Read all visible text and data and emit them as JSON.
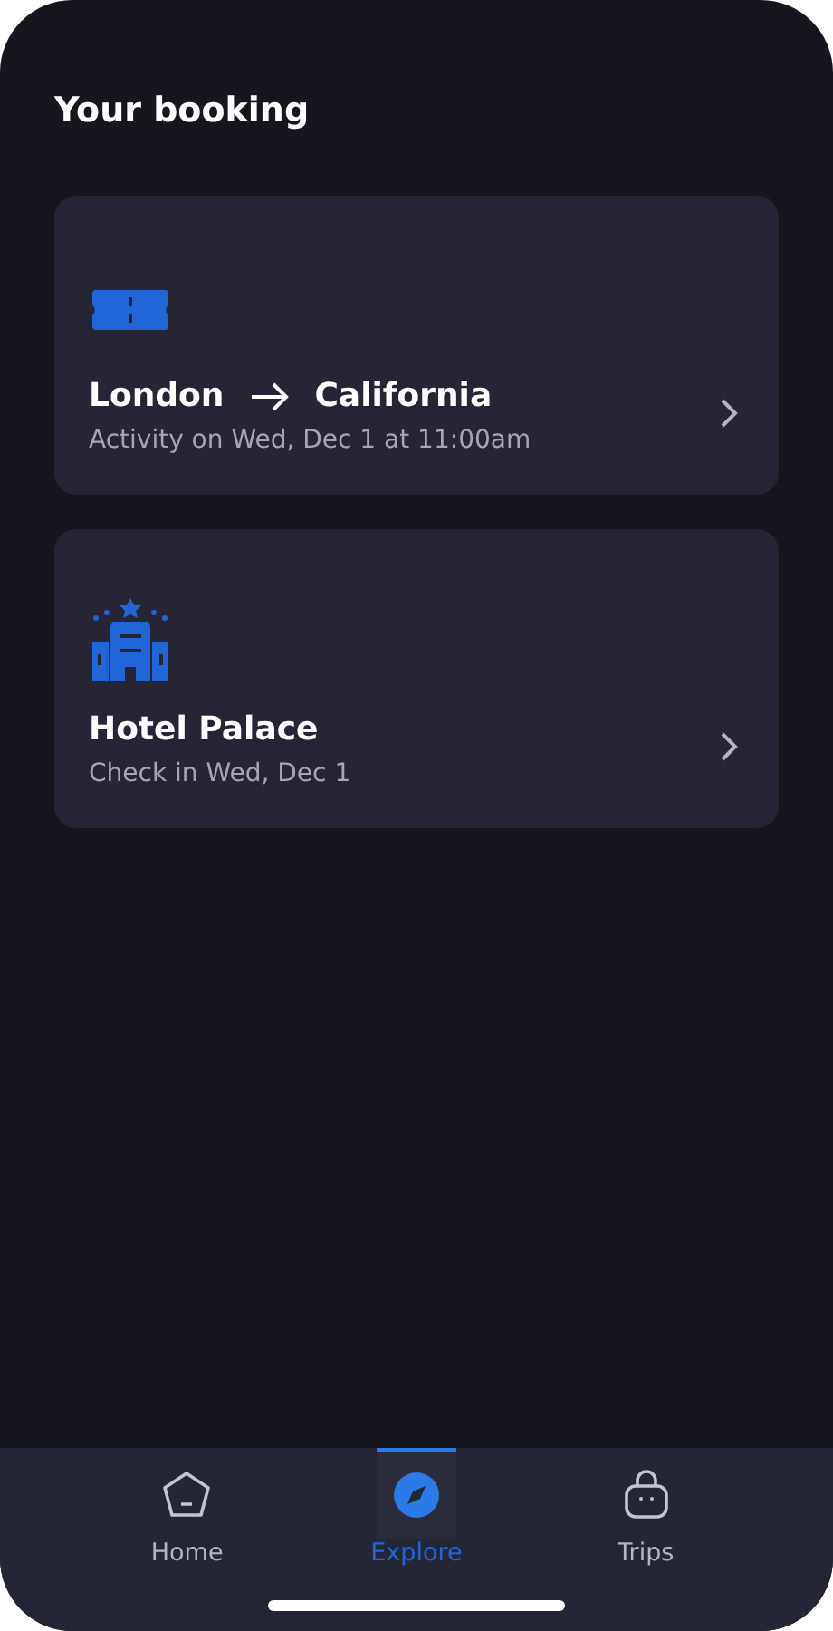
{
  "header": {
    "title": "Your booking"
  },
  "bookings": [
    {
      "kind": "activity",
      "from": "London",
      "to": "California",
      "subtitle": "Activity on Wed, Dec 1 at 11:00am"
    },
    {
      "kind": "hotel",
      "title": "Hotel Palace",
      "subtitle": "Check in Wed, Dec 1"
    }
  ],
  "tab_bar": [
    {
      "label": "Home",
      "selected": false
    },
    {
      "label": "Explore",
      "selected": true
    },
    {
      "label": "Trips",
      "selected": false
    }
  ]
}
